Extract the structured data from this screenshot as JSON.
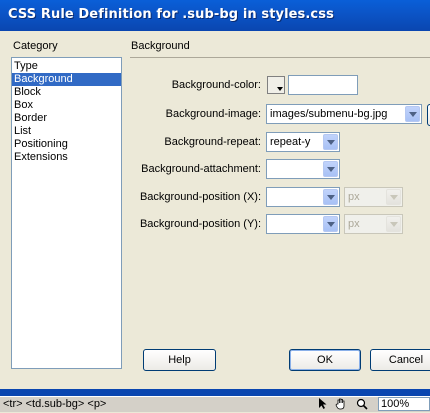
{
  "window": {
    "title": "CSS Rule Definition for .sub-bg in styles.css"
  },
  "category": {
    "header": "Category",
    "items": [
      "Type",
      "Background",
      "Block",
      "Box",
      "Border",
      "List",
      "Positioning",
      "Extensions"
    ],
    "selected": "Background"
  },
  "panel": {
    "header": "Background",
    "bg_color_label": "Background-color:",
    "bg_color_value": "",
    "bg_image_label": "Background-image:",
    "bg_image_value": "images/submenu-bg.jpg",
    "bg_repeat_label": "Background-repeat:",
    "bg_repeat_value": "repeat-y",
    "bg_attachment_label": "Background-attachment:",
    "bg_attachment_value": "",
    "bg_pos_x_label": "Background-position (X):",
    "bg_pos_x_value": "",
    "bg_pos_x_unit": "px",
    "bg_pos_y_label": "Background-position (Y):",
    "bg_pos_y_value": "",
    "bg_pos_y_unit": "px"
  },
  "buttons": {
    "help": "Help",
    "ok": "OK",
    "cancel": "Cancel"
  },
  "statusbar": {
    "path": "<tr> <td.sub-bg> <p>",
    "zoom": "100%"
  },
  "icons": {
    "pointer": "pointer-icon",
    "hand": "hand-icon",
    "zoom": "zoom-icon"
  },
  "colors": {
    "title_bar": "#0a5fd8",
    "selection": "#316ac5",
    "dialog": "#ece9d8"
  }
}
